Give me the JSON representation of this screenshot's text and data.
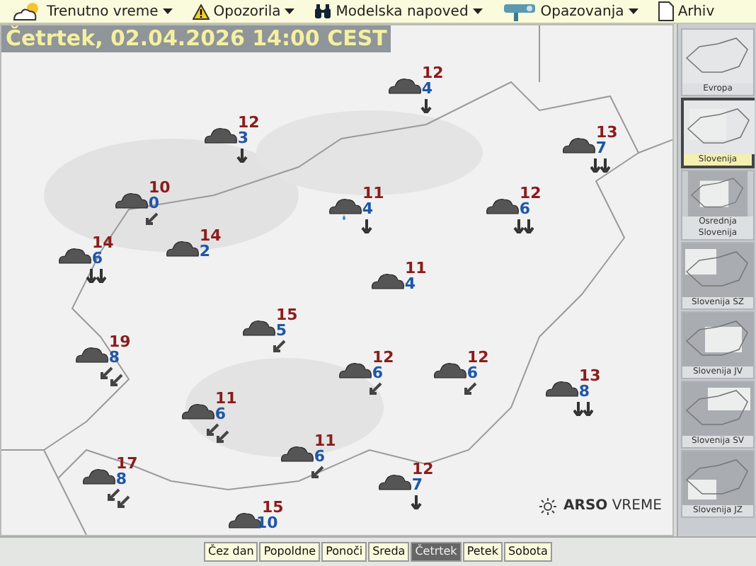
{
  "menu": [
    {
      "label": "Trenutno vreme",
      "dropdown": true
    },
    {
      "label": "Opozorila",
      "dropdown": true
    },
    {
      "label": "Modelska napoved",
      "dropdown": true
    },
    {
      "label": "Opazovanja",
      "dropdown": true
    },
    {
      "label": "Arhiv",
      "dropdown": false
    }
  ],
  "map": {
    "title": "Četrtek, 02.04.2026 14:00 CEST",
    "logo_bold": "ARSO",
    "logo_light": "VREME",
    "stations": [
      {
        "temp": "12",
        "wind": "4",
        "kind": "south",
        "rain": false
      },
      {
        "temp": "12",
        "wind": "3",
        "kind": "south",
        "rain": false
      },
      {
        "temp": "13",
        "wind": "7",
        "kind": "southpair",
        "rain": false
      },
      {
        "temp": "10",
        "wind": "0",
        "kind": "southwest",
        "rain": false
      },
      {
        "temp": "11",
        "wind": "4",
        "kind": "south",
        "rain": true
      },
      {
        "temp": "12",
        "wind": "6",
        "kind": "southpair",
        "rain": false
      },
      {
        "temp": "14",
        "wind": "6",
        "kind": "southpair",
        "rain": false
      },
      {
        "temp": "14",
        "wind": "2",
        "kind": "calm",
        "rain": false
      },
      {
        "temp": "11",
        "wind": "4",
        "kind": "calm",
        "rain": false
      },
      {
        "temp": "15",
        "wind": "5",
        "kind": "southwest",
        "rain": false
      },
      {
        "temp": "19",
        "wind": "8",
        "kind": "southwestpair",
        "rain": false
      },
      {
        "temp": "12",
        "wind": "6",
        "kind": "southwest",
        "rain": false
      },
      {
        "temp": "12",
        "wind": "6",
        "kind": "southwest",
        "rain": false
      },
      {
        "temp": "13",
        "wind": "8",
        "kind": "southpair",
        "rain": false
      },
      {
        "temp": "11",
        "wind": "6",
        "kind": "southwestpair",
        "rain": false
      },
      {
        "temp": "11",
        "wind": "6",
        "kind": "southwest",
        "rain": false
      },
      {
        "temp": "17",
        "wind": "8",
        "kind": "southwestpair",
        "rain": false
      },
      {
        "temp": "12",
        "wind": "7",
        "kind": "south",
        "rain": false
      },
      {
        "temp": "15",
        "wind": "10",
        "kind": "calm",
        "rain": false
      }
    ]
  },
  "regions": [
    {
      "label": "Evropa",
      "selected": false
    },
    {
      "label": "Slovenija",
      "selected": true
    },
    {
      "label": "Osrednja Slovenija",
      "selected": false
    },
    {
      "label": "Slovenija SZ",
      "selected": false
    },
    {
      "label": "Slovenija JV",
      "selected": false
    },
    {
      "label": "Slovenija SV",
      "selected": false
    },
    {
      "label": "Slovenija JZ",
      "selected": false
    }
  ],
  "days": [
    {
      "label": "Čez dan",
      "selected": false
    },
    {
      "label": "Popoldne",
      "selected": false
    },
    {
      "label": "Ponoči",
      "selected": false
    },
    {
      "label": "Sreda",
      "selected": false
    },
    {
      "label": "Četrtek",
      "selected": true
    },
    {
      "label": "Petek",
      "selected": false
    },
    {
      "label": "Sobota",
      "selected": false
    }
  ]
}
